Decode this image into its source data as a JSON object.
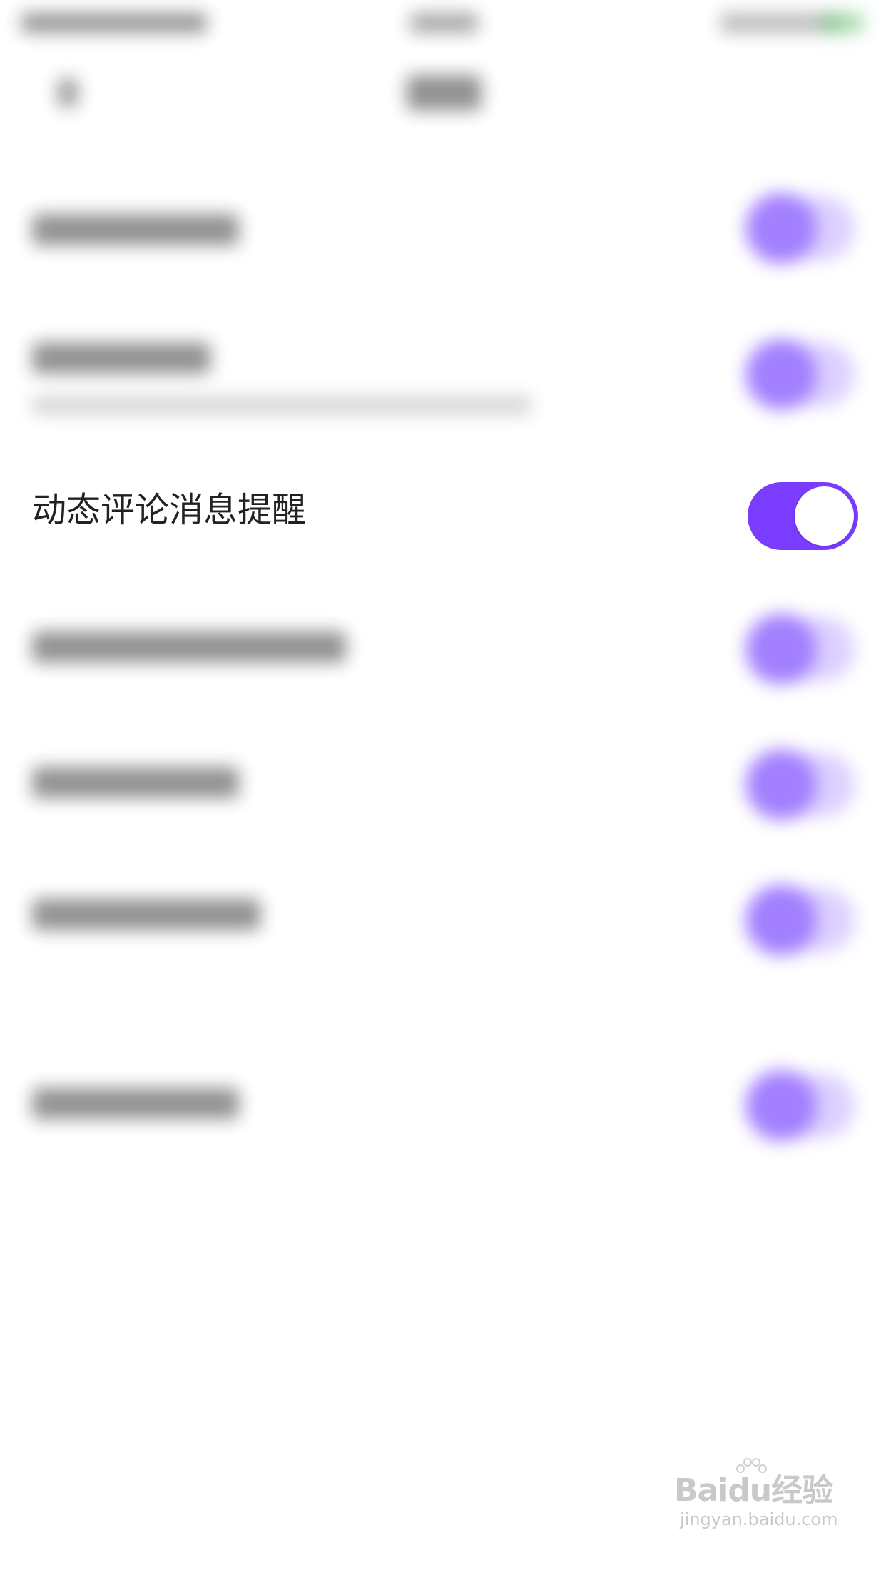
{
  "focused_setting": {
    "label": "动态评论消息提醒",
    "enabled": true
  },
  "colors": {
    "toggle_on": "#7a3cff",
    "toggle_blurred": "#a88cff",
    "background": "#ffffff",
    "text": "#222222"
  },
  "watermark": {
    "logo": "Baidu经验",
    "url": "jingyan.baidu.com"
  }
}
